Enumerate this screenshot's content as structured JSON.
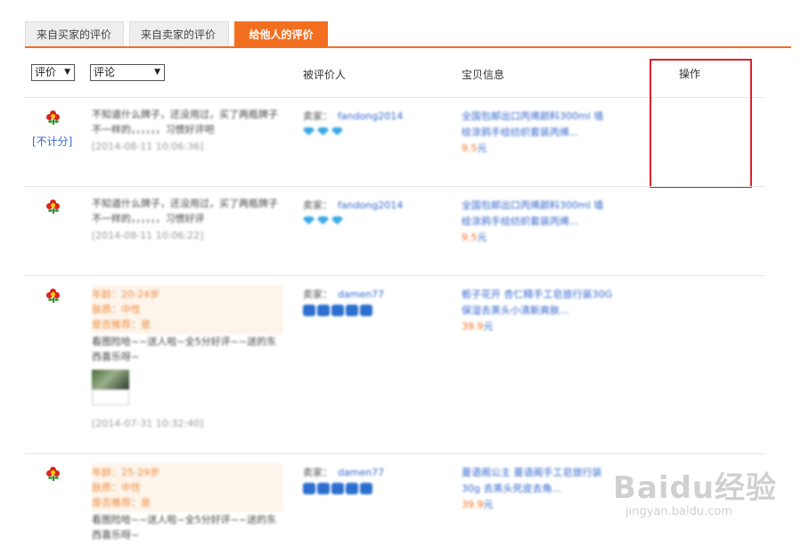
{
  "tabs": [
    "来自买家的评价",
    "来自卖家的评价",
    "给他人的评价"
  ],
  "header": {
    "rating_select": "评价",
    "comment_select": "评论",
    "person_col": "被评价人",
    "item_col": "宝贝信息",
    "op_col": "操作"
  },
  "rows": [
    {
      "rating_note": "[不计分]",
      "comment": "不知道什么牌子，还没用过，买了两瓶牌子不一样的，，，，，，习惯好评吧",
      "date": "[2014-08-11 10:06:36]",
      "seller_label": "卖家：",
      "seller_name": "fandong2014",
      "item_title": "全国包邮出口丙烯颜料300ml 墙绘涂鸦手绘纺织套装丙烯...",
      "price": "9.5",
      "yuan": "元"
    },
    {
      "comment": "不知道什么牌子，还没用过，买了两瓶牌子不一样的，，，，，，习惯好评",
      "date": "[2014-08-11 10:06:22]",
      "seller_label": "卖家：",
      "seller_name": "fandong2014",
      "item_title": "全国包邮出口丙烯颜料300ml 墙绘涂鸦手绘纺织套装丙烯...",
      "price": "9.5",
      "yuan": "元"
    },
    {
      "extra": [
        "年龄：20-24岁",
        "肤质：中性",
        "是否推荐：是"
      ],
      "comment": "看图险哈~~送人啦~全5分好评~~送的东西喜乐呀~",
      "date": "[2014-07-31 10:32:40]",
      "seller_label": "卖家：",
      "seller_name": "damen77",
      "item_title": "栀子花开 杏仁精手工皂旅行装30G 保湿去黑头小清新爽肤...",
      "price": "39.9",
      "yuan": "元"
    },
    {
      "extra": [
        "年龄：25-29岁",
        "肤质：中性",
        "是否推荐：是"
      ],
      "comment": "看图险哈~~送人啦~全5分好评~~送的东西喜乐呀~",
      "seller_label": "卖家：",
      "seller_name": "damen77",
      "item_title": "蔓语阁公主 蔓语阁手工皂旅行装30g 去黑头死皮去角...",
      "price": "39.9",
      "yuan": "元"
    }
  ],
  "watermark": {
    "main": "Baidu经验",
    "sub": "jingyan.baidu.com"
  },
  "colors": {
    "accent": "#f36f20",
    "highlight": "#e0202a",
    "link": "#3366cc"
  }
}
